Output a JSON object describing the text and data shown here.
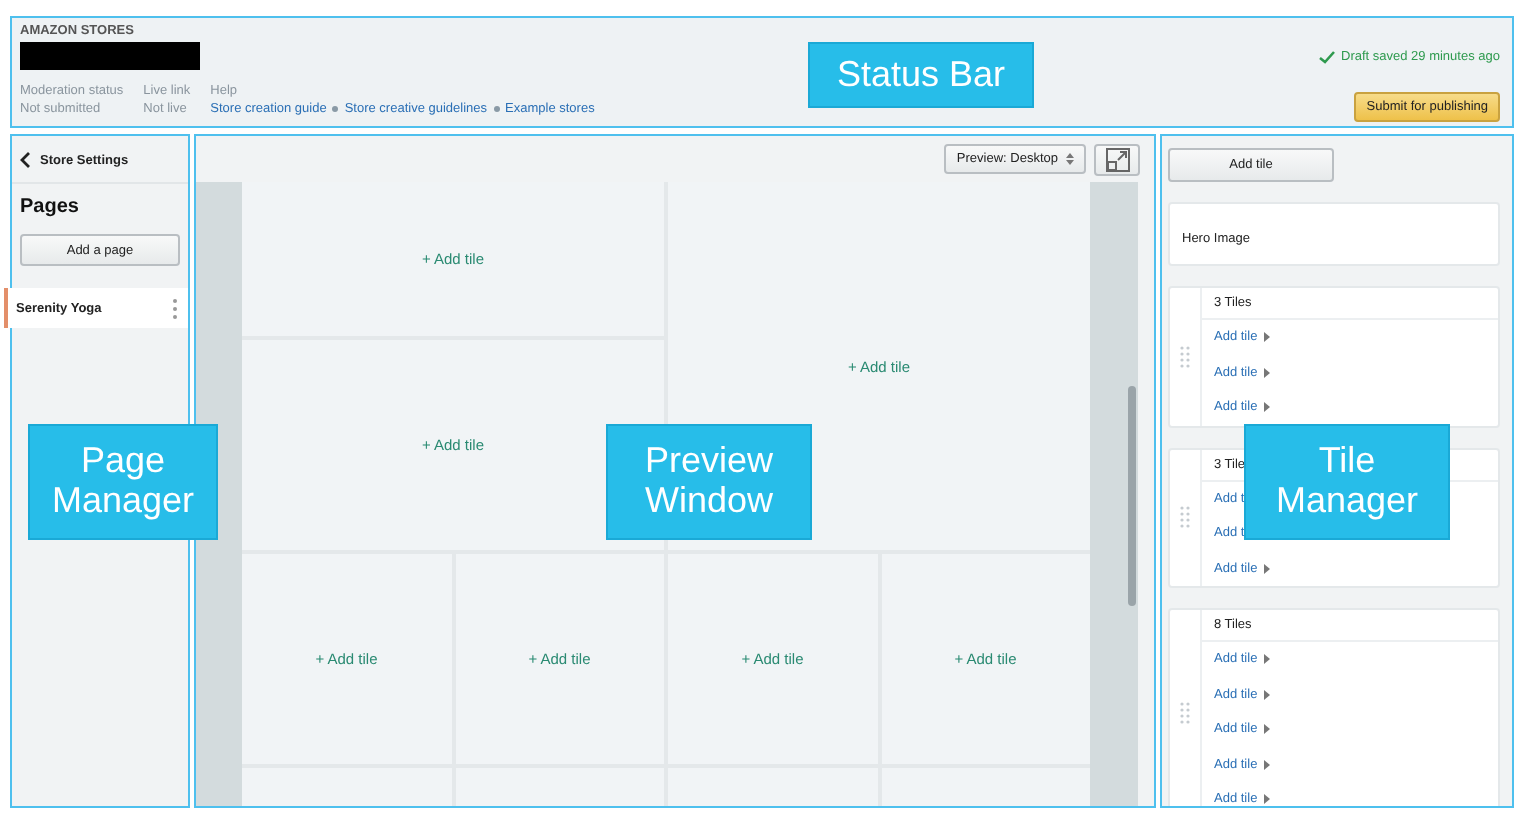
{
  "status_bar": {
    "brand": "AMAZON STORES",
    "fields": [
      {
        "label": "Moderation status",
        "value": "Not submitted"
      },
      {
        "label": "Live link",
        "value": "Not live"
      }
    ],
    "help": {
      "label": "Help",
      "links": [
        "Store creation guide",
        "Store creative guidelines",
        "Example stores"
      ]
    },
    "draft_status": "Draft saved 29 minutes ago",
    "submit_button": "Submit for publishing"
  },
  "page_manager": {
    "back_link": "Store Settings",
    "heading": "Pages",
    "add_button": "Add a page",
    "pages": [
      {
        "name": "Serenity Yoga",
        "selected": true
      }
    ]
  },
  "preview": {
    "device_select": "Preview: Desktop",
    "tiles": [
      {
        "kind": "half",
        "label": "+ Add tile"
      },
      {
        "kind": "half-tall",
        "label": "+ Add tile"
      },
      {
        "kind": "half",
        "label": "+ Add tile"
      },
      {
        "kind": "quarter",
        "label": "+ Add tile"
      },
      {
        "kind": "quarter",
        "label": "+ Add tile"
      },
      {
        "kind": "quarter",
        "label": "+ Add tile"
      },
      {
        "kind": "quarter",
        "label": "+ Add tile"
      },
      {
        "kind": "quarter"
      },
      {
        "kind": "quarter"
      },
      {
        "kind": "quarter"
      },
      {
        "kind": "quarter"
      }
    ]
  },
  "tile_manager": {
    "add_button": "Add tile",
    "sections": [
      {
        "kind": "single",
        "title": "Hero Image"
      },
      {
        "kind": "group",
        "title": "3 Tiles",
        "slots": [
          "Add tile",
          "Add tile",
          "Add tile"
        ]
      },
      {
        "kind": "group",
        "title": "3 Tile",
        "slots": [
          "Add t",
          "Add t",
          "Add tile"
        ]
      },
      {
        "kind": "group",
        "title": "8 Tiles",
        "slots": [
          "Add tile",
          "Add tile",
          "Add tile",
          "Add tile",
          "Add tile"
        ]
      }
    ]
  },
  "annotations": [
    {
      "kind": "status",
      "label": "Status Bar"
    },
    {
      "kind": "pages",
      "label": "Page Manager"
    },
    {
      "kind": "preview",
      "label": "Preview Window"
    },
    {
      "kind": "tiles",
      "label": "Tile Manager"
    }
  ]
}
